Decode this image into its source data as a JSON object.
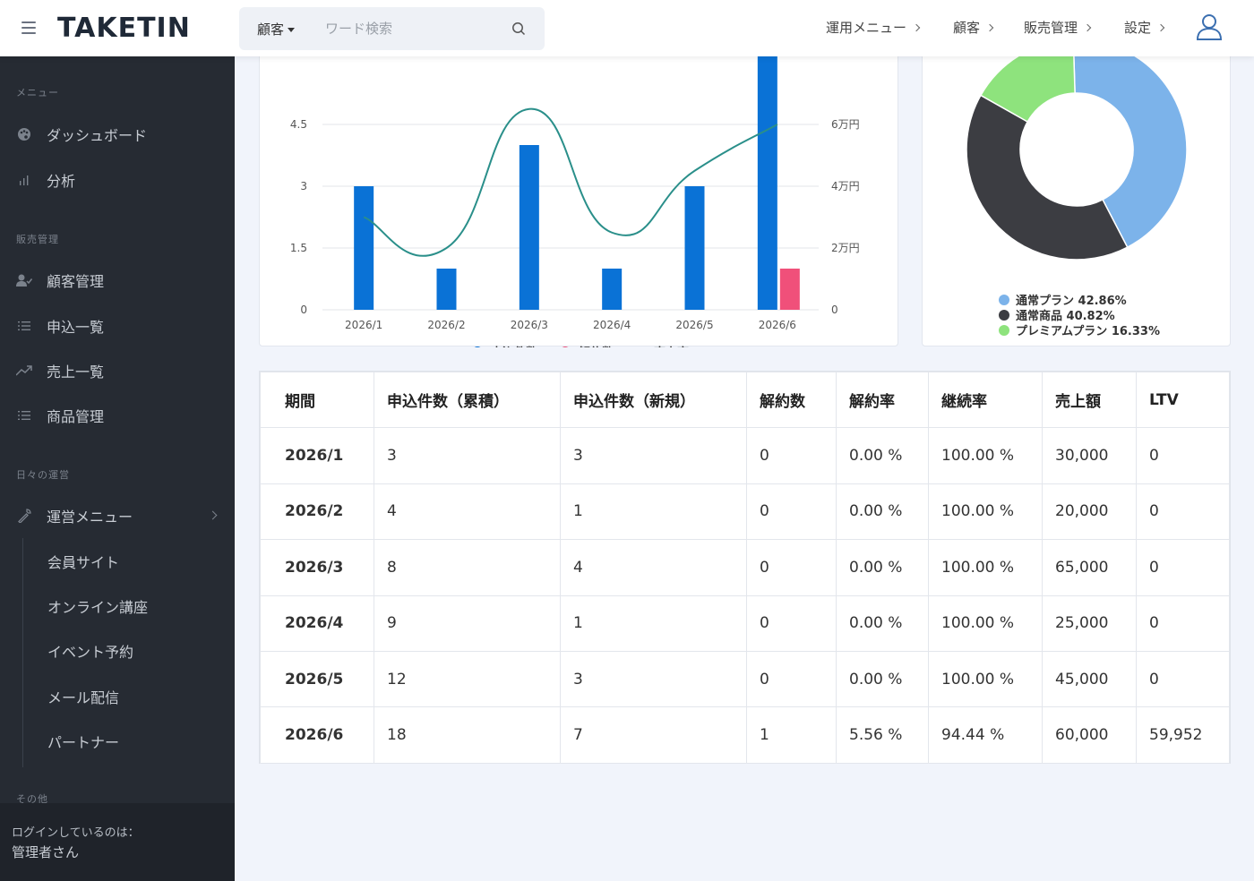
{
  "header": {
    "logo": "TAKETIN",
    "search_select": "顧客",
    "search_placeholder": "ワード検索",
    "nav": [
      "運用メニュー",
      "顧客",
      "販売管理",
      "設定"
    ]
  },
  "sidebar": {
    "sections": {
      "menu": "メニュー",
      "sales": "販売管理",
      "daily": "日々の運営",
      "other": "その他"
    },
    "items": [
      {
        "label": "ダッシュボード",
        "icon": "palette-icon"
      },
      {
        "label": "分析",
        "icon": "bar-chart-icon"
      },
      {
        "label": "顧客管理",
        "icon": "users-icon"
      },
      {
        "label": "申込一覧",
        "icon": "list-icon"
      },
      {
        "label": "売上一覧",
        "icon": "trend-icon"
      },
      {
        "label": "商品管理",
        "icon": "list-icon"
      },
      {
        "label": "運営メニュー",
        "icon": "wrench-icon"
      }
    ],
    "subitems": [
      "会員サイト",
      "オンライン講座",
      "イベント予約",
      "メール配信",
      "パートナー"
    ],
    "footer": {
      "line1": "ログインしているのは：",
      "line2": "管理者さん"
    }
  },
  "chart_data": [
    {
      "type": "bar",
      "categories": [
        "2026/1",
        "2026/2",
        "2026/3",
        "2026/4",
        "2026/5",
        "2026/6"
      ],
      "series": [
        {
          "name": "申込件数",
          "type": "bar",
          "values": [
            3,
            1,
            4,
            1,
            3,
            7
          ],
          "color": "#0a72d6"
        },
        {
          "name": "解約数",
          "type": "bar",
          "values": [
            0,
            0,
            0,
            0,
            0,
            1
          ],
          "color": "#f0507a"
        },
        {
          "name": "売上高",
          "type": "line",
          "values": [
            30000,
            20000,
            65000,
            25000,
            45000,
            60000
          ],
          "color": "#2a8f8a"
        }
      ],
      "y_left_ticks": [
        "0",
        "1.5",
        "3",
        "4.5"
      ],
      "y_right_ticks": [
        "0",
        "2万円",
        "4万円",
        "6万円"
      ],
      "ylim_left": [
        0,
        6
      ],
      "ylim_right": [
        0,
        80000
      ]
    },
    {
      "type": "pie",
      "slices": [
        {
          "name": "通常プラン",
          "value": 42.86,
          "label": "42.86%",
          "color": "#7cb3ea"
        },
        {
          "name": "通常商品",
          "value": 40.82,
          "label": "40.82%",
          "color": "#3c3d42"
        },
        {
          "name": "プレミアムプラン",
          "value": 16.33,
          "label": "16.33%",
          "color": "#8ee37d"
        }
      ]
    }
  ],
  "table": {
    "headers": [
      "期間",
      "申込件数（累積）",
      "申込件数（新規）",
      "解約数",
      "解約率",
      "継続率",
      "売上額",
      "LTV"
    ],
    "rows": [
      [
        "2026/1",
        "3",
        "3",
        "0",
        "0.00 %",
        "100.00 %",
        "30,000",
        "0"
      ],
      [
        "2026/2",
        "4",
        "1",
        "0",
        "0.00 %",
        "100.00 %",
        "20,000",
        "0"
      ],
      [
        "2026/3",
        "8",
        "4",
        "0",
        "0.00 %",
        "100.00 %",
        "65,000",
        "0"
      ],
      [
        "2026/4",
        "9",
        "1",
        "0",
        "0.00 %",
        "100.00 %",
        "25,000",
        "0"
      ],
      [
        "2026/5",
        "12",
        "3",
        "0",
        "0.00 %",
        "100.00 %",
        "45,000",
        "0"
      ],
      [
        "2026/6",
        "18",
        "7",
        "1",
        "5.56 %",
        "94.44 %",
        "60,000",
        "59,952"
      ]
    ]
  }
}
